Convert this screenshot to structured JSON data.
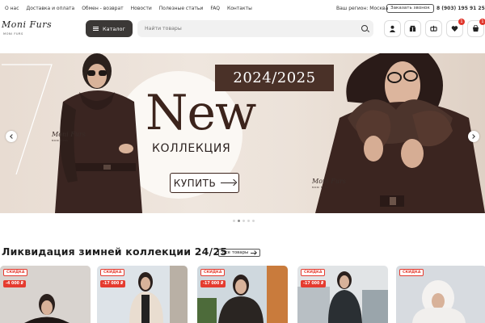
{
  "topbar": {
    "nav": [
      "О нас",
      "Доставка и оплата",
      "Обмен - возврат",
      "Новости",
      "Полезные статьи",
      "FAQ",
      "Контакты"
    ],
    "region": "Ваш регион: Москва",
    "callback": "Заказать звонок",
    "phone": "8 (903) 195 91 25"
  },
  "header": {
    "logo_text": "Moni Furs",
    "logo_sub": "MONI FURS",
    "catalog_label": "Каталог",
    "search_placeholder": "Найти товары",
    "icons": [
      "user-icon",
      "box-icon",
      "scales-icon",
      "heart-icon",
      "cart-icon"
    ],
    "badges": {
      "heart": "1",
      "cart": "1"
    }
  },
  "banner": {
    "year": "2024/2025",
    "headline": "New",
    "subtitle": "КОЛЛЕКЦИЯ",
    "cta": "КУПИТЬ",
    "signature": "Moni Furs",
    "signature_sub": "MONI FURS",
    "slides_count": 5,
    "active_slide": 1
  },
  "section": {
    "title": "Ликвидация зимней коллекции 24/25",
    "all_button": "Все товары"
  },
  "products": [
    {
      "tag": "СКИДКА",
      "price": "-4 000 ₽"
    },
    {
      "tag": "СКИДКА",
      "price": "-17 000 ₽"
    },
    {
      "tag": "СКИДКА",
      "price": "-17 000 ₽"
    },
    {
      "tag": "СКИДКА",
      "price": "-17 000 ₽"
    },
    {
      "tag": "СКИДКА",
      "price": ""
    }
  ],
  "colors": {
    "accent": "#3b3836",
    "sale": "#e53b2f",
    "banner_brown": "#4a3128"
  }
}
